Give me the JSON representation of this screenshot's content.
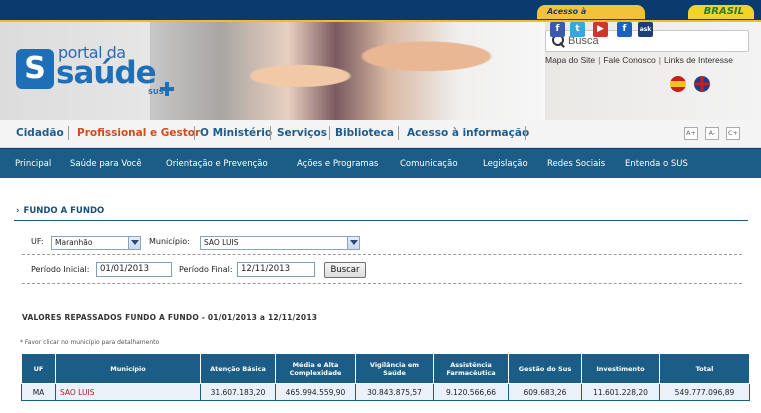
{
  "gov_bar": {
    "acesso_label": "Acesso à Informação",
    "brasil_label": "BRASIL"
  },
  "logo": {
    "portal": "portal da",
    "saude": "saúde",
    "sus": "SUS"
  },
  "search": {
    "placeholder": "Busca"
  },
  "utility_links": [
    "Mapa do Site",
    "Fale Conosco",
    "Links de Interesse"
  ],
  "social_icons": [
    "facebook-icon",
    "twitter-icon",
    "youtube-icon",
    "flickr-icon",
    "ask-icon"
  ],
  "social_glyphs": {
    "facebook": "f",
    "twitter": "t",
    "youtube": "▶",
    "flickr": "f",
    "ask": "ask"
  },
  "language_flags": [
    "spanish-flag-icon",
    "english-flag-icon"
  ],
  "primary_nav": [
    "Cidadão",
    "Profissional e Gestor",
    "O Ministério",
    "Serviços",
    "Biblioteca",
    "Acesso à informação"
  ],
  "font_size_buttons": [
    "A+",
    "A-",
    "C+"
  ],
  "secondary_nav": [
    "Principal",
    "Saúde para Você",
    "Orientação e Prevenção",
    "Ações e Programas",
    "Comunicação",
    "Legislação",
    "Redes Sociais",
    "Entenda o SUS"
  ],
  "page": {
    "title": "FUNDO A FUNDO",
    "arrow": "›"
  },
  "filters": {
    "uf_label": "UF:",
    "uf_value": "Maranhão",
    "municipio_label": "Município:",
    "municipio_value": "SAO LUIS",
    "periodo_inicial_label": "Período Inicial:",
    "periodo_inicial_value": "01/01/2013",
    "periodo_final_label": "Período Final:",
    "periodo_final_value": "12/11/2013",
    "search_button": "Buscar"
  },
  "results": {
    "title": "VALORES REPASSADOS FUNDO A FUNDO - 01/01/2013 a 12/11/2013",
    "hint": "* Favor clicar no município para detalhamento",
    "columns": [
      "UF",
      "Município",
      "Atenção Básica",
      "Média e Alta Complexidade",
      "Vigilância em Saúde",
      "Assistência Farmacêutica",
      "Gestão do Sus",
      "Investimento",
      "Total"
    ],
    "rows": [
      [
        "MA",
        "SAO LUIS",
        "31.607.183,20",
        "465.994.559,90",
        "30.843.875,57",
        "9.120.566,66",
        "609.683,26",
        "11.601.228,20",
        "549.777.096,89"
      ]
    ]
  },
  "colors": {
    "brand_blue": "#1b5d86",
    "nav_text": "#1f5c8e",
    "active_nav": "#d24b1c",
    "link_red": "#b21d1d"
  }
}
